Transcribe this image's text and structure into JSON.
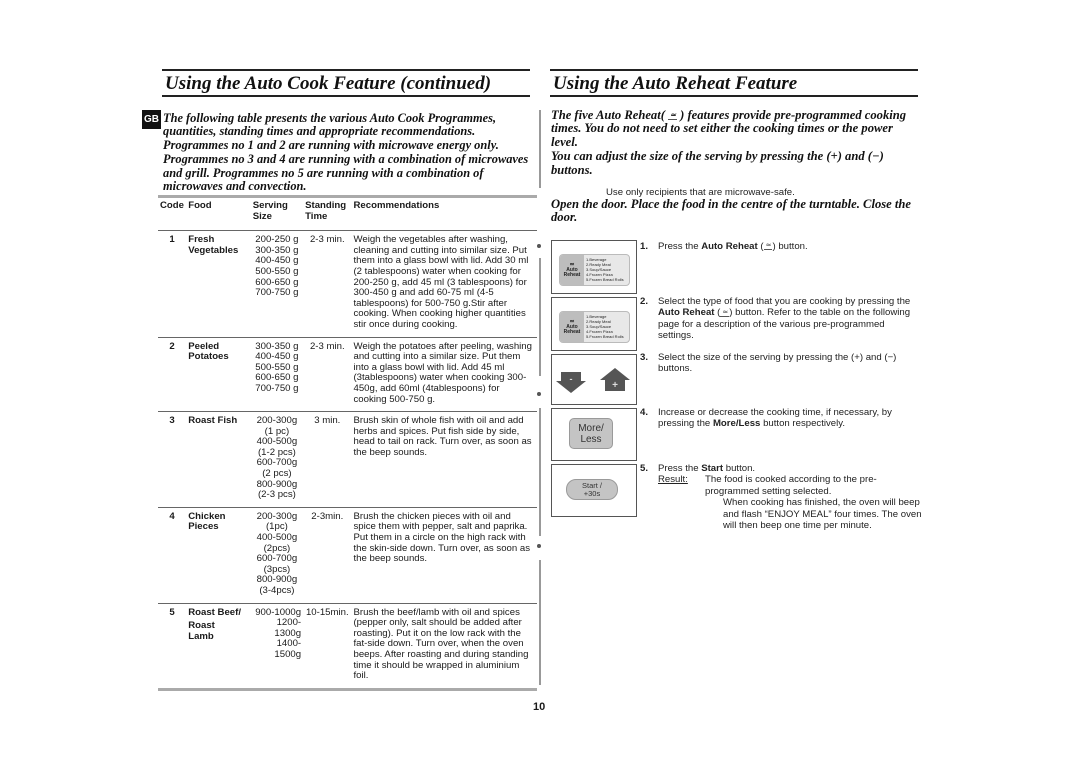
{
  "left": {
    "title": "Using the Auto Cook Feature (continued)",
    "lang_badge": "GB",
    "intro_lines": [
      "The following table presents the various Auto Cook Programmes,",
      "quantities, standing times and appropriate recommendations.",
      "Programmes no 1 and 2 are running with microwave energy only.",
      "Programmes no 3 and 4 are running with a combination of microwaves",
      "and grill. Programmes no 5 are running with a combination of",
      "microwaves and convection."
    ],
    "table": {
      "headers": [
        "Code",
        "Food",
        "Serving Size",
        "Standing Time",
        "Recommendations"
      ],
      "header_lines": {
        "code": "Code",
        "food": "Food",
        "size": [
          "Serving",
          "Size"
        ],
        "stand": [
          "Standing",
          "Time"
        ],
        "rec": "Recommendations"
      },
      "rows": [
        {
          "code": "1",
          "food": [
            "Fresh",
            "Vegetables"
          ],
          "sizes": [
            "200-250 g",
            "300-350 g",
            "400-450 g",
            "500-550 g",
            "600-650 g",
            "700-750 g"
          ],
          "standing": "2-3 min.",
          "recommendation": "Weigh the vegetables after washing, cleaning and cutting into similar size. Put them into a glass bowl with lid. Add 30 ml (2 tablespoons) water when cooking for 200-250 g, add 45 ml  (3 tablespoons) for 300-450 g and add 60-75 ml (4-5 tablespoons) for 500-750 g.Stir after cooking. When cooking higher quantities stir once during cooking."
        },
        {
          "code": "2",
          "food": [
            "Peeled",
            "Potatoes"
          ],
          "sizes": [
            "300-350 g",
            "400-450 g",
            "500-550 g",
            "600-650 g",
            "700-750 g"
          ],
          "standing": "2-3 min.",
          "recommendation": "Weigh the potatoes after peeling, washing and cutting into a similar size. Put them into a glass bowl with lid. Add 45 ml (3tablespoons) water when cooking 300-450g, add 60ml (4tablespoons) for cooking 500-750 g."
        },
        {
          "code": "3",
          "food": [
            "Roast Fish"
          ],
          "sizes": [
            "200-300g",
            "(1 pc)",
            "400-500g",
            "(1-2 pcs)",
            "600-700g",
            "(2 pcs)",
            "800-900g",
            "(2-3 pcs)"
          ],
          "standing": "3 min.",
          "recommendation": "Brush skin of whole fish with oil and add herbs and spices. Put fish side by side, head to tail on rack. Turn over, as soon as the beep sounds."
        },
        {
          "code": "4",
          "food": [
            "Chicken",
            "Pieces"
          ],
          "sizes": [
            "200-300g",
            "(1pc)",
            "400-500g",
            "(2pcs)",
            "600-700g",
            "(3pcs)",
            "800-900g",
            "(3-4pcs)"
          ],
          "standing": "2-3min.",
          "recommendation": "Brush the chicken pieces with oil and spice them with pepper, salt and paprika. Put them in a circle on the high rack with the skin-side down. Turn over, as soon as the beep sounds."
        },
        {
          "code": "5",
          "food": [
            "Roast Beef/",
            "Roast",
            "Lamb"
          ],
          "sizes": [
            "900-1000g",
            "1200-1300g",
            "1400-1500g"
          ],
          "standing": "10-15min.",
          "recommendation": "Brush the beef/lamb with oil and spices (pepper only, salt should be added after roasting). Put it on the low rack with the fat-side down. Turn over, when the oven beeps. After roasting and during standing time it should be wrapped in aluminium foil."
        }
      ]
    }
  },
  "right": {
    "title": "Using the Auto Reheat Feature",
    "intro": {
      "p1_before": "The five Auto Reheat(",
      "p1_after": ") features provide pre-programmed cooking times. You do not need to set either the cooking times or the power level.",
      "p2": "You can adjust the size of the serving by pressing the (+) and (−) buttons."
    },
    "note": "Use only recipients that are microwave-safe.",
    "instruction": "Open the door. Place the food in the centre of the turntable. Close the door.",
    "panel": {
      "button_label": [
        "Auto",
        "Reheat"
      ],
      "items": [
        "1.Beverage",
        "2.Ready Meal",
        "3.Soup/Sauce",
        "4.Frozen Pizza",
        "5.Frozen Bread Rolls"
      ]
    },
    "arrows": {
      "minus": "-",
      "plus": "+"
    },
    "more_less_label": [
      "More/",
      "Less"
    ],
    "start_label": [
      "Start  /",
      "+30s"
    ],
    "steps": [
      {
        "num": "1.",
        "text_a": "Press the ",
        "bold": "Auto Reheat",
        "text_b": " (",
        "text_c": ") button."
      },
      {
        "num": "2.",
        "text_a": "Select the type of food that you are cooking by pressing the ",
        "bold": "Auto Reheat",
        "text_b": " (",
        "text_c": ") button. Refer to the table on the following page for a description of the various pre-programmed settings."
      },
      {
        "num": "3.",
        "text": "Select the size of the serving by pressing the (+) and (−) buttons."
      },
      {
        "num": "4.",
        "text_a": "Increase or decrease the cooking time, if necessary, by pressing the ",
        "bold": "More/Less",
        "text_c": " button respectively."
      },
      {
        "num": "5.",
        "text_a": "Press the ",
        "bold": "Start",
        "text_c": " button.",
        "result_label": "Result:",
        "result_text": "The food is cooked according to the pre-programmed setting selected.",
        "result_extra": "When cooking has finished, the oven will beep and flash “ENJOY MEAL” four times. The oven will then beep one time per minute."
      }
    ]
  },
  "page_number": "10"
}
